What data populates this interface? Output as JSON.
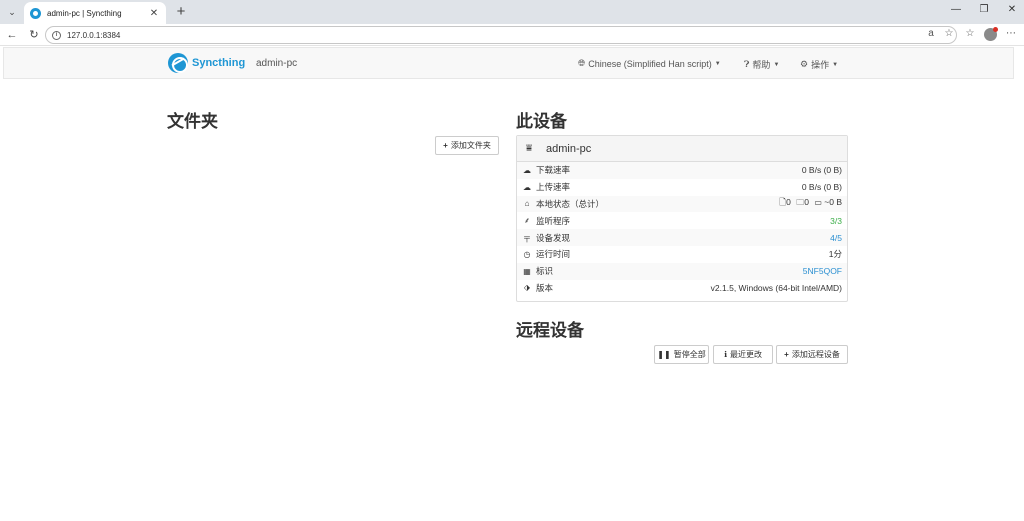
{
  "browser": {
    "tab_title": "admin-pc | Syncthing",
    "url": "127.0.0.1:8384"
  },
  "navbar": {
    "brand": "Syncthing",
    "device": "admin-pc",
    "language_menu": "Chinese (Simplified Han script)",
    "help_menu": "帮助",
    "actions_menu": "操作"
  },
  "folders": {
    "title": "文件夹",
    "add_button": "添加文件夹"
  },
  "this_device": {
    "title": "此设备",
    "name": "admin-pc",
    "rows": [
      {
        "label": "下载速率",
        "value": "0 B/s (0 B)",
        "icon": "cloud-download-icon"
      },
      {
        "label": "上传速率",
        "value": "0 B/s (0 B)",
        "icon": "cloud-upload-icon"
      },
      {
        "label": "本地状态（总计）",
        "value": "~0 B",
        "files": "0",
        "dirs": "0",
        "icon": "home-icon"
      },
      {
        "label": "监听程序",
        "value": "3/3",
        "icon": "sitemap-icon"
      },
      {
        "label": "设备发现",
        "value": "4/5",
        "icon": "signpost-icon"
      },
      {
        "label": "运行时间",
        "value": "1分",
        "icon": "clock-icon"
      },
      {
        "label": "标识",
        "value": "5NF5QOF",
        "icon": "qrcode-icon"
      },
      {
        "label": "版本",
        "value": "v2.1.5, Windows (64-bit Intel/AMD)",
        "icon": "tag-icon"
      }
    ]
  },
  "remote_devices": {
    "title": "远程设备",
    "pause_all": "暂停全部",
    "recent_changes": "最近更改",
    "add_device": "添加远程设备"
  }
}
